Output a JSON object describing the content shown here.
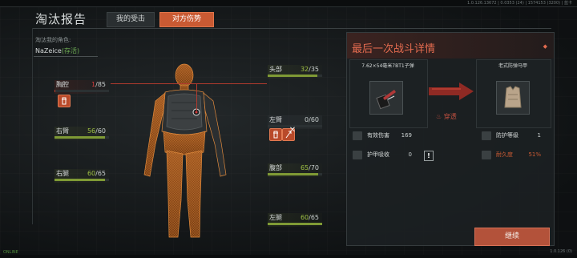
{
  "system_info": "1.0.126.13672 | 0.0353 (24) | 1574153 (3200) | 蓝卡",
  "header": {
    "title": "淘汰报告",
    "tab_mine": "我的受击",
    "tab_opponent": "对方伤势"
  },
  "killer": {
    "label": "淘汰我的角色:",
    "name": "NaZeice",
    "status": "(存活)"
  },
  "body_parts": {
    "thorax": {
      "name": "胸腔",
      "current": "1",
      "max": "/85",
      "fraction": 0.012
    },
    "head": {
      "name": "头部",
      "current": "32",
      "max": "/35",
      "fraction": 0.914
    },
    "right_arm": {
      "name": "右臂",
      "current": "56",
      "max": "/60",
      "fraction": 0.933
    },
    "left_arm": {
      "name": "左臂",
      "current": "0",
      "max": "/60",
      "fraction": 0.0
    },
    "stomach": {
      "name": "腹部",
      "current": "65",
      "max": "/70",
      "fraction": 0.929
    },
    "right_leg": {
      "name": "右腿",
      "current": "60",
      "max": "/65",
      "fraction": 0.923
    },
    "left_leg": {
      "name": "左腿",
      "current": "60",
      "max": "/65",
      "fraction": 1.0
    }
  },
  "detail": {
    "title": "最后一次战斗详情",
    "corner_mark": "◆",
    "weapon_name": "7.62×54毫米7BT1子弹",
    "armor_name": "老式防弹马甲",
    "penetration": "穿透",
    "weapon_stats": [
      {
        "label": "有效伤害",
        "value": "169"
      },
      {
        "label": "护甲吸收",
        "value": "0"
      }
    ],
    "armor_stats": [
      {
        "label": "防护等级",
        "value": "1"
      },
      {
        "label": "耐久度",
        "value": "51%"
      }
    ],
    "alert": "!"
  },
  "footer": {
    "continue_label": "继续",
    "bottom_right": "1.0.126 (0)",
    "bottom_left": "ONLINE"
  },
  "colors": {
    "accent": "#c95a33",
    "health_good": "#9fc144",
    "health_bad": "#d13a3a",
    "title_red": "#e36b4f"
  }
}
